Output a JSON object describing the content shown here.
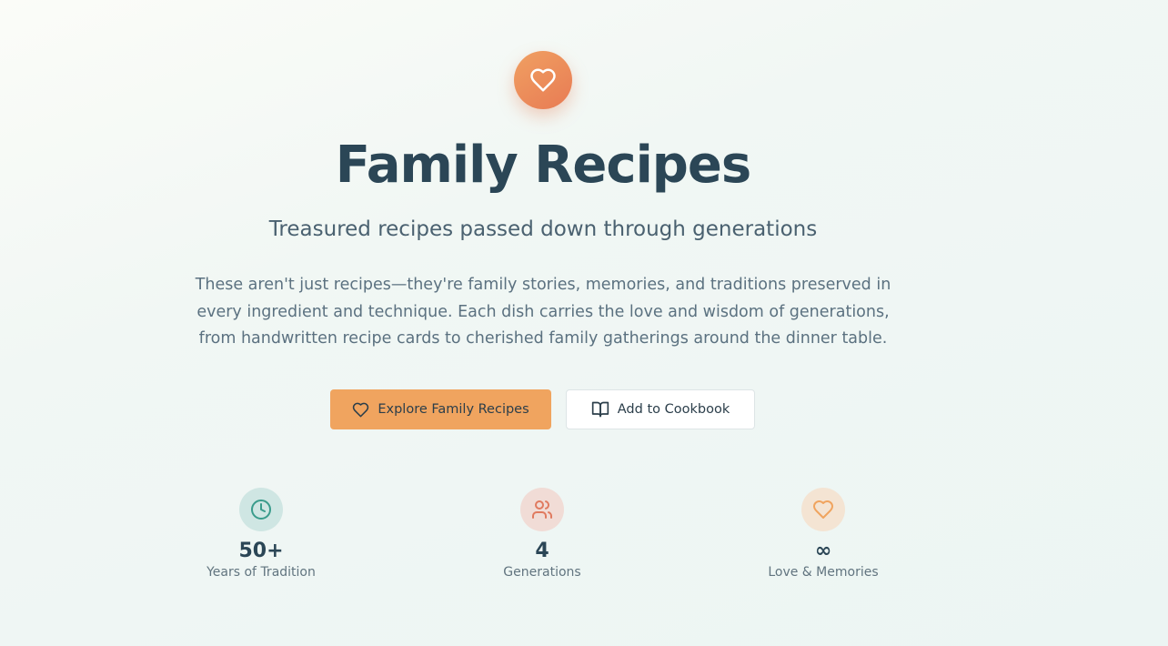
{
  "hero": {
    "title": "Family Recipes",
    "subtitle": "Treasured recipes passed down through generations",
    "description": "These aren't just recipes—they're family stories, memories, and traditions preserved in every ingredient and technique. Each dish carries the love and wisdom of generations, from handwritten recipe cards to cherished family gatherings around the dinner table.",
    "logo_icon": "heart-icon"
  },
  "actions": {
    "primary_label": "Explore Family Recipes",
    "primary_icon": "heart-icon",
    "secondary_label": "Add to Cookbook",
    "secondary_icon": "book-open-icon"
  },
  "stats": [
    {
      "icon": "clock-icon",
      "value": "50+",
      "label": "Years of Tradition",
      "color": "#3a9c8c"
    },
    {
      "icon": "users-icon",
      "value": "4",
      "label": "Generations",
      "color": "#e07a5f"
    },
    {
      "icon": "heart-icon",
      "value": "∞",
      "label": "Love & Memories",
      "color": "#f0a45f"
    }
  ],
  "colors": {
    "accent": "#f0a45f",
    "logo_gradient_start": "#f0a062",
    "logo_gradient_end": "#e87b54",
    "heading": "#2b4656"
  }
}
